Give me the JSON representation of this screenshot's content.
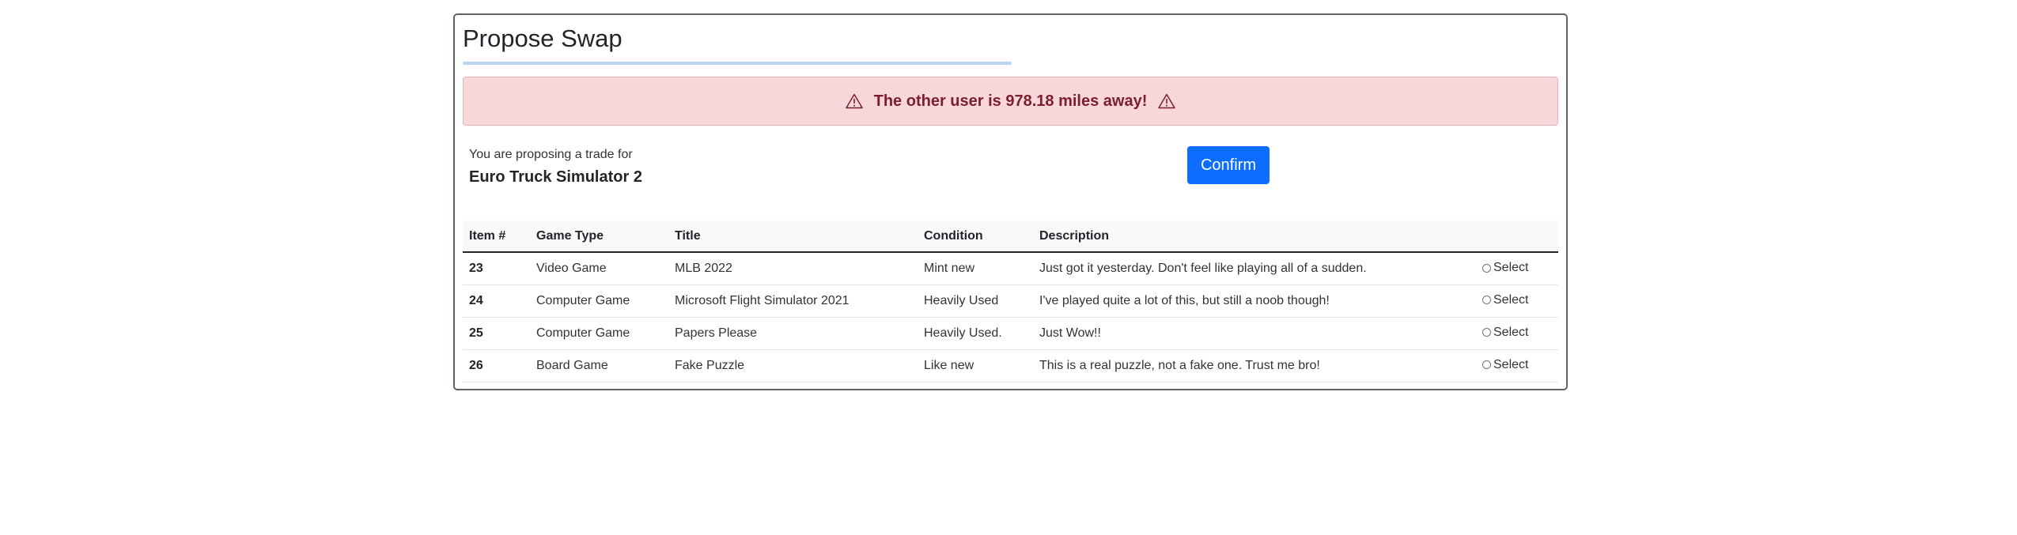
{
  "header": {
    "title": "Propose Swap"
  },
  "alert": {
    "text": "The other user is 978.18 miles away!",
    "icon": "warning-icon"
  },
  "proposal": {
    "label": "You are proposing a trade for",
    "game": "Euro Truck Simulator 2"
  },
  "actions": {
    "confirm_label": "Confirm"
  },
  "table": {
    "headers": [
      "Item #",
      "Game Type",
      "Title",
      "Condition",
      "Description",
      ""
    ],
    "rows": [
      {
        "item": "23",
        "type": "Video Game",
        "title": "MLB 2022",
        "condition": "Mint new",
        "description": "Just got it yesterday. Don't feel like playing all of a sudden.",
        "select_label": "Select"
      },
      {
        "item": "24",
        "type": "Computer Game",
        "title": "Microsoft Flight Simulator 2021",
        "condition": "Heavily Used",
        "description": "I've played quite a lot of this, but still a noob though!",
        "select_label": "Select"
      },
      {
        "item": "25",
        "type": "Computer Game",
        "title": "Papers Please",
        "condition": "Heavily Used.",
        "description": "Just Wow!!",
        "select_label": "Select"
      },
      {
        "item": "26",
        "type": "Board Game",
        "title": "Fake Puzzle",
        "condition": "Like new",
        "description": "This is a real puzzle, not a fake one. Trust me bro!",
        "select_label": "Select"
      }
    ]
  },
  "colors": {
    "primary": "#0d6efd",
    "alert_bg": "#f8d7da",
    "alert_text": "#7a1f2b",
    "underline": "#bcd3f2"
  }
}
